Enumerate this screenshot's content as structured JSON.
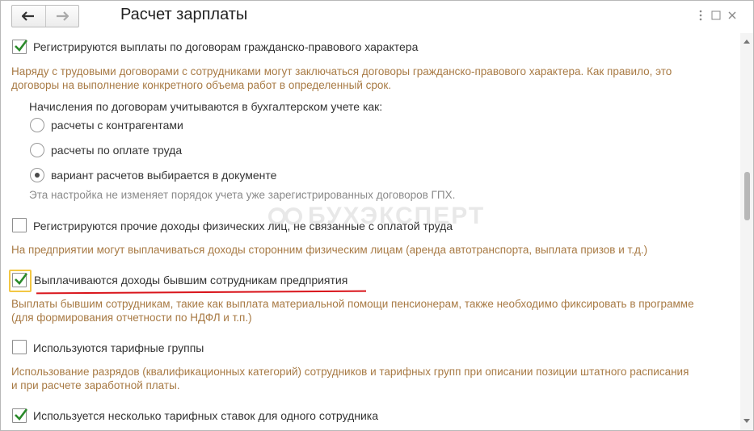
{
  "header": {
    "title": "Расчет зарплаты",
    "back_icon": "arrow-left-icon",
    "forward_icon": "arrow-right-icon"
  },
  "settings": {
    "gph": {
      "label": "Регистрируются выплаты по договорам гражданско-правового характера",
      "checked": true,
      "description": "Наряду с трудовыми договорами с сотрудниками могут заключаться договоры гражданско-правового характера. Как правило, это договоры на выполнение конкретного объема работ в определенный срок.",
      "accounting_label": "Начисления по договорам учитываются в бухгалтерском учете как:",
      "options": [
        {
          "label": "расчеты с контрагентами",
          "selected": false
        },
        {
          "label": "расчеты по оплате труда",
          "selected": false
        },
        {
          "label": "вариант расчетов выбирается в документе",
          "selected": true
        }
      ],
      "options_note": "Эта настройка не изменяет порядок учета уже зарегистрированных договоров ГПХ."
    },
    "other_income": {
      "label": "Регистрируются прочие доходы физических лиц, не связанные с оплатой труда",
      "checked": false,
      "description": "На предприятии могут выплачиваться доходы сторонним физическим лицам (аренда автотранспорта, выплата призов и т.д.)"
    },
    "former_employees": {
      "label": "Выплачиваются доходы бывшим сотрудникам предприятия",
      "checked": true,
      "description": "Выплаты бывшим сотрудникам, такие как выплата материальной помощи пенсионерам, также необходимо фиксировать в программе (для формирования отчетности по НДФЛ и т.п.)"
    },
    "tariff_groups": {
      "label": "Используются тарифные группы",
      "checked": false,
      "description": "Использование разрядов (квалификационных категорий) сотрудников и тарифных групп при описании позиции штатного расписания и при расчете заработной платы."
    },
    "multiple_rates": {
      "label": "Используется несколько тарифных ставок для одного сотрудника",
      "checked": true
    }
  },
  "watermark": {
    "text": "БУХЭКСПЕРТ"
  },
  "colors": {
    "accent_check": "#2a8a2a",
    "note_text": "#a87a44",
    "highlight_underline": "#d9141b",
    "focus_border": "#f2c744"
  }
}
